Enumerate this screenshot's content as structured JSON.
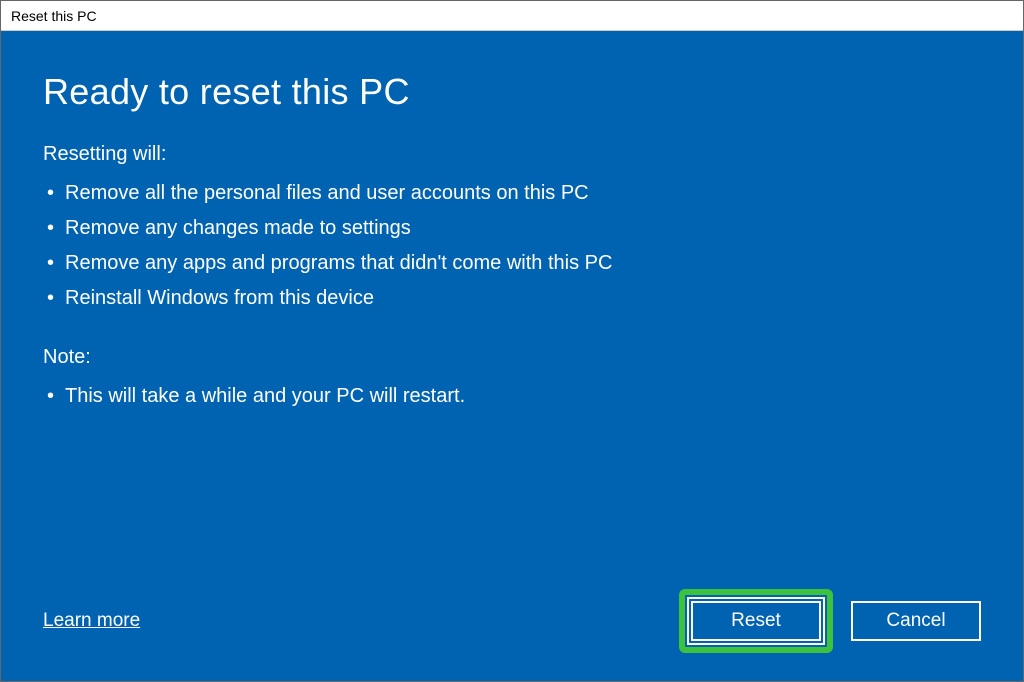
{
  "window": {
    "title": "Reset this PC"
  },
  "main": {
    "heading": "Ready to reset this PC",
    "section1_label": "Resetting will:",
    "section1_items": [
      "Remove all the personal files and user accounts on this PC",
      "Remove any changes made to settings",
      "Remove any apps and programs that didn't come with this PC",
      "Reinstall Windows from this device"
    ],
    "section2_label": "Note:",
    "section2_items": [
      "This will take a while and your PC will restart."
    ]
  },
  "footer": {
    "learn_more": "Learn more",
    "reset_label": "Reset",
    "cancel_label": "Cancel"
  }
}
